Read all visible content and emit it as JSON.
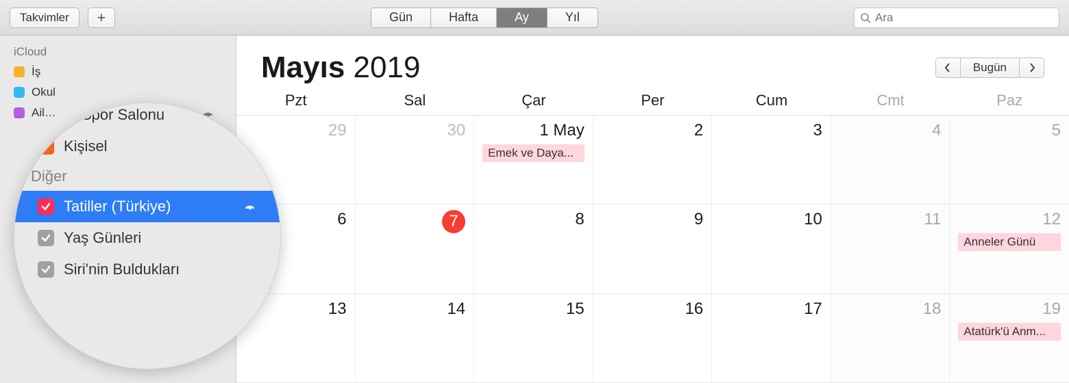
{
  "toolbar": {
    "calendars_label": "Takvimler",
    "view": {
      "day": "Gün",
      "week": "Hafta",
      "month": "Ay",
      "year": "Yıl",
      "active": "month"
    }
  },
  "search": {
    "placeholder": "Ara"
  },
  "sidebar": {
    "group1": {
      "label": "iCloud",
      "items": [
        {
          "name": "work",
          "label": "İş",
          "color": "#f7b22b"
        },
        {
          "name": "school",
          "label": "Okul",
          "color": "#35b7f2"
        },
        {
          "name": "family",
          "label": "Ail…",
          "color": "#b25ee3",
          "shared": true
        }
      ]
    }
  },
  "magnifier": {
    "top_items": [
      {
        "label": "Spor Salonu",
        "color": "#f06517"
      },
      {
        "label": "Kişisel",
        "color": "#f06517"
      }
    ],
    "group_label": "Diğer",
    "items": [
      {
        "label": "Tatiller (Türkiye)",
        "color": "#ff2d55",
        "selected": true,
        "shared": true
      },
      {
        "label": "Yaş Günleri",
        "color": "#a0a0a0"
      },
      {
        "label": "Siri'nin Buldukları",
        "color": "#a0a0a0"
      }
    ]
  },
  "calendar": {
    "month": "Mayıs",
    "year": "2019",
    "today_label": "Bugün",
    "days": [
      "Pzt",
      "Sal",
      "Çar",
      "Per",
      "Cum",
      "Cmt",
      "Paz"
    ],
    "weeks": [
      [
        {
          "n": "29",
          "other": true
        },
        {
          "n": "30",
          "other": true
        },
        {
          "n": "1 May",
          "event": "Emek ve Daya..."
        },
        {
          "n": "2"
        },
        {
          "n": "3"
        },
        {
          "n": "4",
          "wk": true
        },
        {
          "n": "5",
          "wk": true
        }
      ],
      [
        {
          "n": "6"
        },
        {
          "n": "7",
          "today": true
        },
        {
          "n": "8"
        },
        {
          "n": "9"
        },
        {
          "n": "10"
        },
        {
          "n": "11",
          "wk": true
        },
        {
          "n": "12",
          "wk": true,
          "event": "Anneler Günü"
        }
      ],
      [
        {
          "n": "13"
        },
        {
          "n": "14"
        },
        {
          "n": "15"
        },
        {
          "n": "16"
        },
        {
          "n": "17"
        },
        {
          "n": "18",
          "wk": true
        },
        {
          "n": "19",
          "wk": true,
          "event": "Atatürk'ü Anm..."
        }
      ]
    ]
  }
}
